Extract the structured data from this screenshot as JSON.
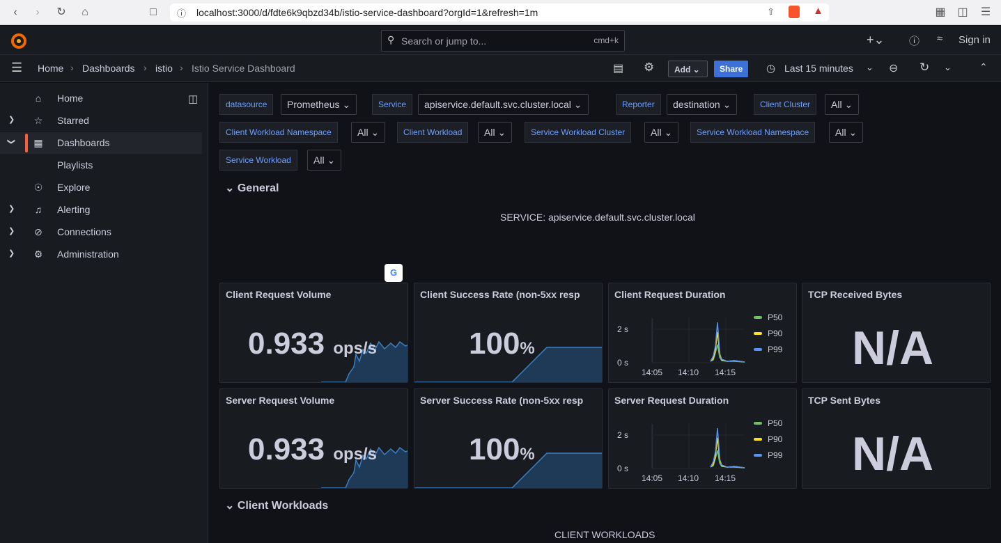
{
  "browser": {
    "url": "localhost:3000/d/fdte6k9qbzd34b/istio-service-dashboard?orgId=1&refresh=1m"
  },
  "topbar": {
    "search_placeholder": "Search or jump to...",
    "search_shortcut": "cmd+k",
    "sign_in": "Sign in"
  },
  "breadcrumbs": [
    "Home",
    "Dashboards",
    "istio",
    "Istio Service Dashboard"
  ],
  "toolbar": {
    "add_label": "Add",
    "share_label": "Share",
    "time_range": "Last 15 minutes"
  },
  "sidebar": {
    "items": [
      {
        "label": "Home"
      },
      {
        "label": "Starred"
      },
      {
        "label": "Dashboards"
      },
      {
        "label": "Playlists"
      },
      {
        "label": "Explore"
      },
      {
        "label": "Alerting"
      },
      {
        "label": "Connections"
      },
      {
        "label": "Administration"
      }
    ]
  },
  "variables": [
    {
      "label": "datasource",
      "value": "Prometheus"
    },
    {
      "label": "Service",
      "value": "apiservice.default.svc.cluster.local"
    },
    {
      "label": "Reporter",
      "value": "destination"
    },
    {
      "label": "Client Cluster",
      "value": "All"
    },
    {
      "label": "Client Workload Namespace",
      "value": "All"
    },
    {
      "label": "Client Workload",
      "value": "All"
    },
    {
      "label": "Service Workload Cluster",
      "value": "All"
    },
    {
      "label": "Service Workload Namespace",
      "value": "All"
    },
    {
      "label": "Service Workload",
      "value": "All"
    }
  ],
  "rows": {
    "general": "General",
    "client_workloads": "Client Workloads"
  },
  "service_text": "SERVICE: apiservice.default.svc.cluster.local",
  "client_workloads_text": "CLIENT WORKLOADS",
  "panels": [
    {
      "title": "Client Request Volume",
      "value": "0.933",
      "unit": "ops/s"
    },
    {
      "title": "Client Success Rate (non-5xx resp",
      "value": "100",
      "unit": "%"
    },
    {
      "title": "Client Request Duration"
    },
    {
      "title": "TCP Received Bytes",
      "value": "N/A"
    },
    {
      "title": "Server Request Volume",
      "value": "0.933",
      "unit": "ops/s"
    },
    {
      "title": "Server Success Rate (non-5xx resp",
      "value": "100",
      "unit": "%"
    },
    {
      "title": "Server Request Duration"
    },
    {
      "title": "TCP Sent Bytes",
      "value": "N/A"
    }
  ],
  "chart_data": [
    {
      "type": "line",
      "title": "Client Request Duration",
      "x_ticks": [
        "14:05",
        "14:10",
        "14:15"
      ],
      "y_ticks": [
        "0 s",
        "2 s"
      ],
      "series": [
        {
          "name": "P50",
          "color": "#73bf69"
        },
        {
          "name": "P90",
          "color": "#fade2a"
        },
        {
          "name": "P99",
          "color": "#5794f2"
        }
      ]
    },
    {
      "type": "line",
      "title": "Server Request Duration",
      "x_ticks": [
        "14:05",
        "14:10",
        "14:15"
      ],
      "y_ticks": [
        "0 s",
        "2 s"
      ],
      "series": [
        {
          "name": "P50",
          "color": "#73bf69"
        },
        {
          "name": "P90",
          "color": "#fade2a"
        },
        {
          "name": "P99",
          "color": "#5794f2"
        }
      ]
    }
  ]
}
